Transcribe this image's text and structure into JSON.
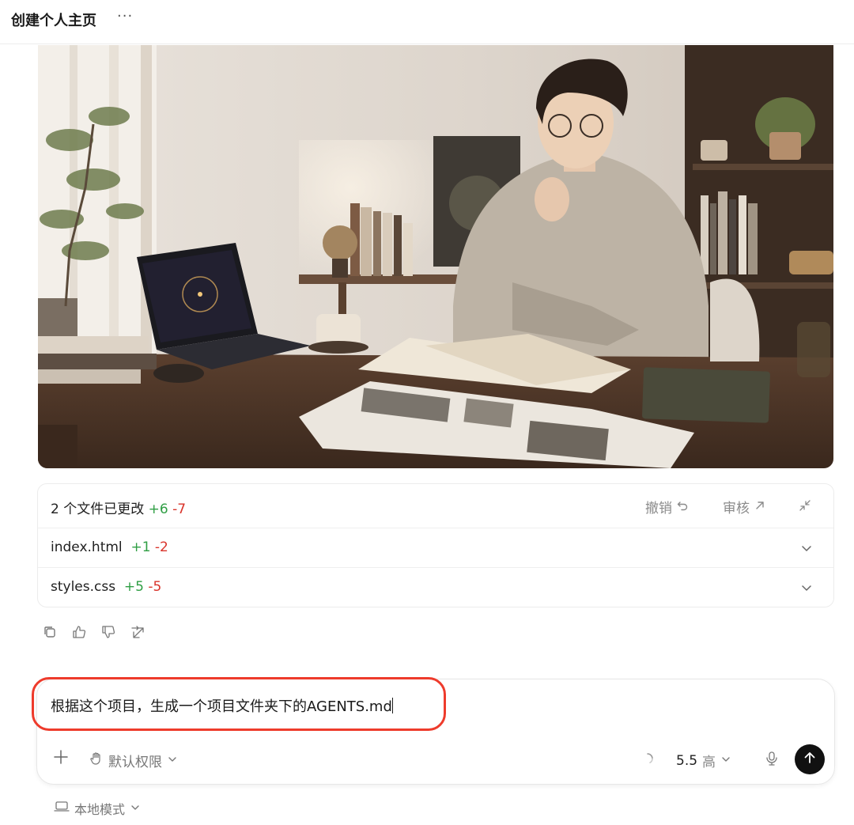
{
  "header": {
    "title": "创建个人主页",
    "more_label": "···"
  },
  "changes": {
    "summary": "2 个文件已更改",
    "total_added": "+6",
    "total_removed": "-7",
    "undo_label": "撤销",
    "review_label": "审核",
    "files": [
      {
        "name": "index.html",
        "added": "+1",
        "removed": "-2"
      },
      {
        "name": "styles.css",
        "added": "+5",
        "removed": "-5"
      }
    ]
  },
  "composer": {
    "text": "根据这个项目，生成一个项目文件夹下的AGENTS.md",
    "permission_label": "默认权限",
    "model_version": "5.5",
    "model_effort": "高"
  },
  "footer": {
    "mode_label": "本地模式"
  },
  "colors": {
    "added": "#2f9e44",
    "removed": "#d9342b",
    "highlight": "#ee3b2c",
    "send_button": "#111111"
  },
  "icons": {
    "feedback": [
      "copy-icon",
      "thumbs-up-icon",
      "thumbs-down-icon",
      "share-icon"
    ],
    "other": [
      "undo-icon",
      "external-arrow-icon",
      "collapse-icon",
      "chevron-down-icon",
      "plus-icon",
      "hand-icon",
      "spinner-icon",
      "mic-icon",
      "arrow-up-icon",
      "laptop-icon"
    ]
  }
}
